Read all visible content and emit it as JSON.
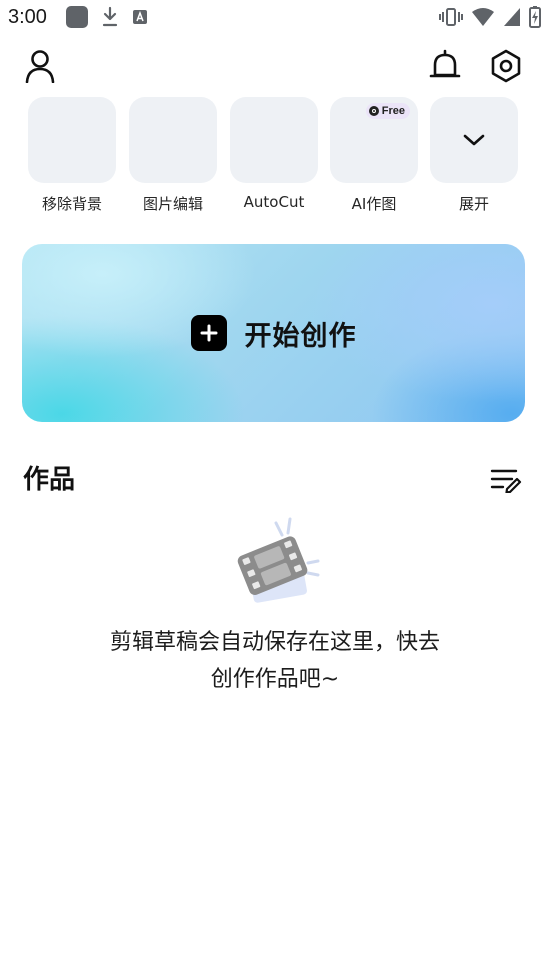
{
  "status_bar": {
    "time": "3:00",
    "icons": [
      "app-square-icon",
      "download-icon",
      "font-a-icon",
      "vibrate-icon",
      "wifi-icon",
      "signal-icon",
      "battery-icon"
    ]
  },
  "top_bar": {
    "icons": [
      "profile-icon",
      "bell-icon",
      "settings-icon"
    ]
  },
  "tools": [
    {
      "label": "移除背景"
    },
    {
      "label": "图片编辑"
    },
    {
      "label": "AutoCut"
    },
    {
      "label": "AI作图",
      "badge": "Free"
    },
    {
      "label": "展开",
      "icon": "chevron-down-icon"
    }
  ],
  "create_banner": {
    "label": "开始创作"
  },
  "works": {
    "title": "作品",
    "empty_text_line1": "剪辑草稿会自动保存在这里，快去",
    "empty_text_line2": "创作作品吧~"
  },
  "colors": {
    "tile_bg": "#eef1f5",
    "banner_cyan": "#46d7e6",
    "banner_blue": "#50aaf0",
    "badge_bg": "#ebe4f8",
    "text_primary": "#111111"
  }
}
